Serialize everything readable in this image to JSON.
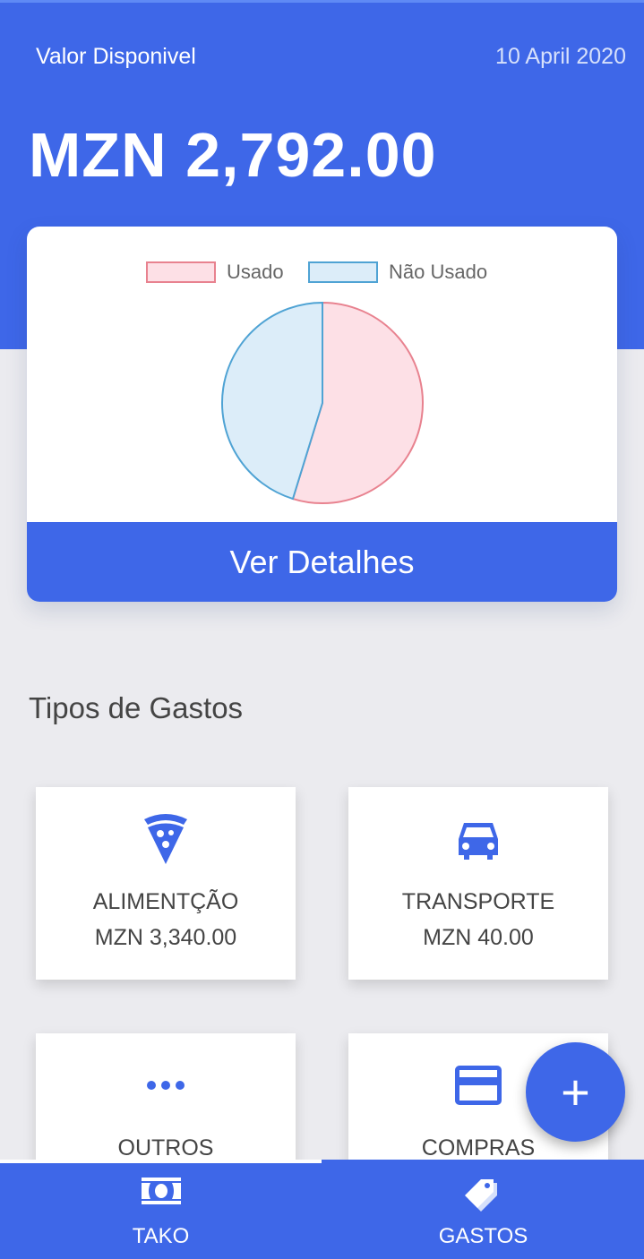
{
  "header": {
    "label": "Valor Disponivel",
    "date": "10 April 2020",
    "balance": "MZN 2,792.00"
  },
  "chart_data": {
    "type": "pie",
    "labels": [
      "Usado",
      "Não Usado"
    ],
    "values": [
      3380,
      2792
    ],
    "colors": [
      "#fde0e6",
      "#dcedf9"
    ],
    "border_colors": [
      "#e8828f",
      "#4fa3d4"
    ],
    "legend_position": "top"
  },
  "card": {
    "details_label": "Ver Detalhes"
  },
  "section": {
    "title": "Tipos de Gastos"
  },
  "categories": [
    {
      "name": "ALIMENTÇÃO",
      "amount": "MZN 3,340.00",
      "icon": "pizza-icon"
    },
    {
      "name": "TRANSPORTE",
      "amount": "MZN 40.00",
      "icon": "car-icon"
    },
    {
      "name": "OUTROS",
      "amount": "",
      "icon": "more-horizontal-icon"
    },
    {
      "name": "COMPRAS",
      "amount": "",
      "icon": "credit-card-icon"
    }
  ],
  "fab": {
    "label": "+"
  },
  "nav": {
    "items": [
      {
        "label": "TAKO",
        "icon": "money-icon",
        "active": true
      },
      {
        "label": "GASTOS",
        "icon": "tags-icon",
        "active": false
      }
    ]
  },
  "colors": {
    "primary": "#3e67e8",
    "background": "#ebebef"
  }
}
